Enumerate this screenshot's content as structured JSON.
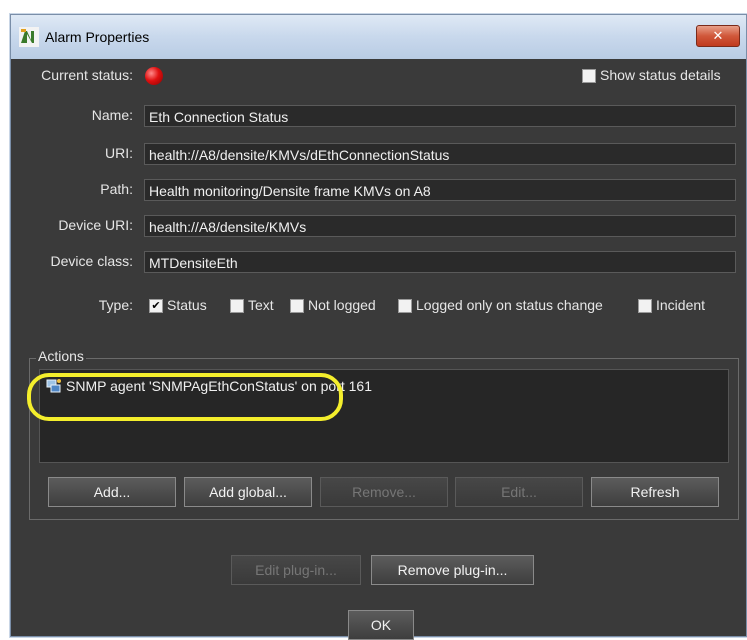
{
  "window": {
    "title": "Alarm Properties",
    "close_glyph": "✕"
  },
  "status": {
    "label": "Current status:",
    "led_color": "#e01010",
    "show_details_label": "Show status details",
    "show_details_checked": false
  },
  "fields": [
    {
      "label": "Name:",
      "value": "Eth Connection Status"
    },
    {
      "label": "URI:",
      "value": "health://A8/densite/KMVs/dEthConnectionStatus"
    },
    {
      "label": "Path:",
      "value": "Health monitoring/Densite frame KMVs on A8"
    },
    {
      "label": "Device URI:",
      "value": "health://A8/densite/KMVs"
    },
    {
      "label": "Device class:",
      "value": "MTDensiteEth"
    }
  ],
  "type": {
    "label": "Type:",
    "options": [
      {
        "label": "Status",
        "checked": true
      },
      {
        "label": "Text",
        "checked": false
      },
      {
        "label": "Not logged",
        "checked": false
      },
      {
        "label": "Logged only on status change",
        "checked": false
      },
      {
        "label": "Incident",
        "checked": false
      }
    ]
  },
  "actions": {
    "legend": "Actions",
    "items": [
      {
        "icon": "snmp-agent-icon",
        "text": "SNMP agent 'SNMPAgEthConStatus' on port 161"
      }
    ],
    "highlight_color": "#f4ee2c",
    "buttons": [
      {
        "label": "Add...",
        "enabled": true
      },
      {
        "label": "Add global...",
        "enabled": true
      },
      {
        "label": "Remove...",
        "enabled": false
      },
      {
        "label": "Edit...",
        "enabled": false
      },
      {
        "label": "Refresh",
        "enabled": true
      }
    ]
  },
  "plugin_buttons": [
    {
      "label": "Edit plug-in...",
      "enabled": false
    },
    {
      "label": "Remove plug-in...",
      "enabled": true
    }
  ],
  "ok_button": {
    "label": "OK"
  }
}
